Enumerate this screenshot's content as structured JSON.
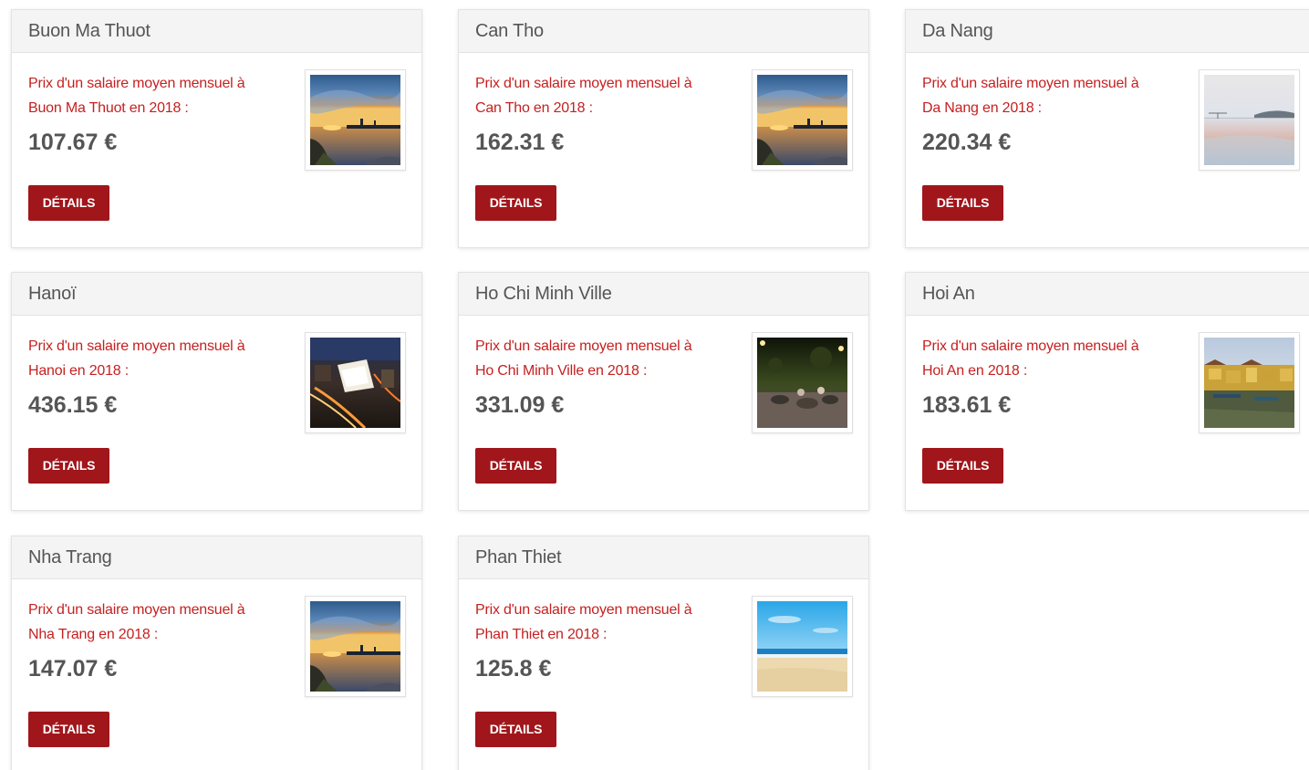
{
  "cards": [
    {
      "city": "Buon Ma Thuot",
      "desc_prefix": "Prix d'un salaire moyen mensuel à",
      "desc_suffix": "Buon Ma Thuot en 2018 :",
      "price": "107.67 €",
      "button": "DÉTAILS",
      "image": "sunset-lake"
    },
    {
      "city": "Can Tho",
      "desc_prefix": "Prix d'un salaire moyen mensuel à",
      "desc_suffix": "Can Tho en 2018 :",
      "price": "162.31 €",
      "button": "DÉTAILS",
      "image": "sunset-lake"
    },
    {
      "city": "Da Nang",
      "desc_prefix": "Prix d'un salaire moyen mensuel à",
      "desc_suffix": "Da Nang en 2018 :",
      "price": "220.34 €",
      "button": "DÉTAILS",
      "image": "misty-water"
    },
    {
      "city": "Hanoï",
      "desc_prefix": "Prix d'un salaire moyen mensuel à",
      "desc_suffix": "Hanoi en 2018 :",
      "price": "436.15 €",
      "button": "DÉTAILS",
      "image": "night-city-aerial"
    },
    {
      "city": "Ho Chi Minh Ville",
      "desc_prefix": "Prix d'un salaire moyen mensuel à",
      "desc_suffix": "Ho Chi Minh Ville en 2018 :",
      "price": "331.09 €",
      "button": "DÉTAILS",
      "image": "night-street"
    },
    {
      "city": "Hoi An",
      "desc_prefix": "Prix d'un salaire moyen mensuel à",
      "desc_suffix": "Hoi An en 2018 :",
      "price": "183.61 €",
      "button": "DÉTAILS",
      "image": "old-town-river"
    },
    {
      "city": "Nha Trang",
      "desc_prefix": "Prix d'un salaire moyen mensuel à",
      "desc_suffix": "Nha Trang en 2018 :",
      "price": "147.07 €",
      "button": "DÉTAILS",
      "image": "sunset-lake"
    },
    {
      "city": "Phan Thiet",
      "desc_prefix": "Prix d'un salaire moyen mensuel à",
      "desc_suffix": "Phan Thiet en 2018 :",
      "price": "125.8 €",
      "button": "DÉTAILS",
      "image": "beach"
    }
  ],
  "colors": {
    "accent": "#a0161b",
    "description_text": "#c62020",
    "header_bg": "#f4f4f4",
    "text": "#555555"
  }
}
